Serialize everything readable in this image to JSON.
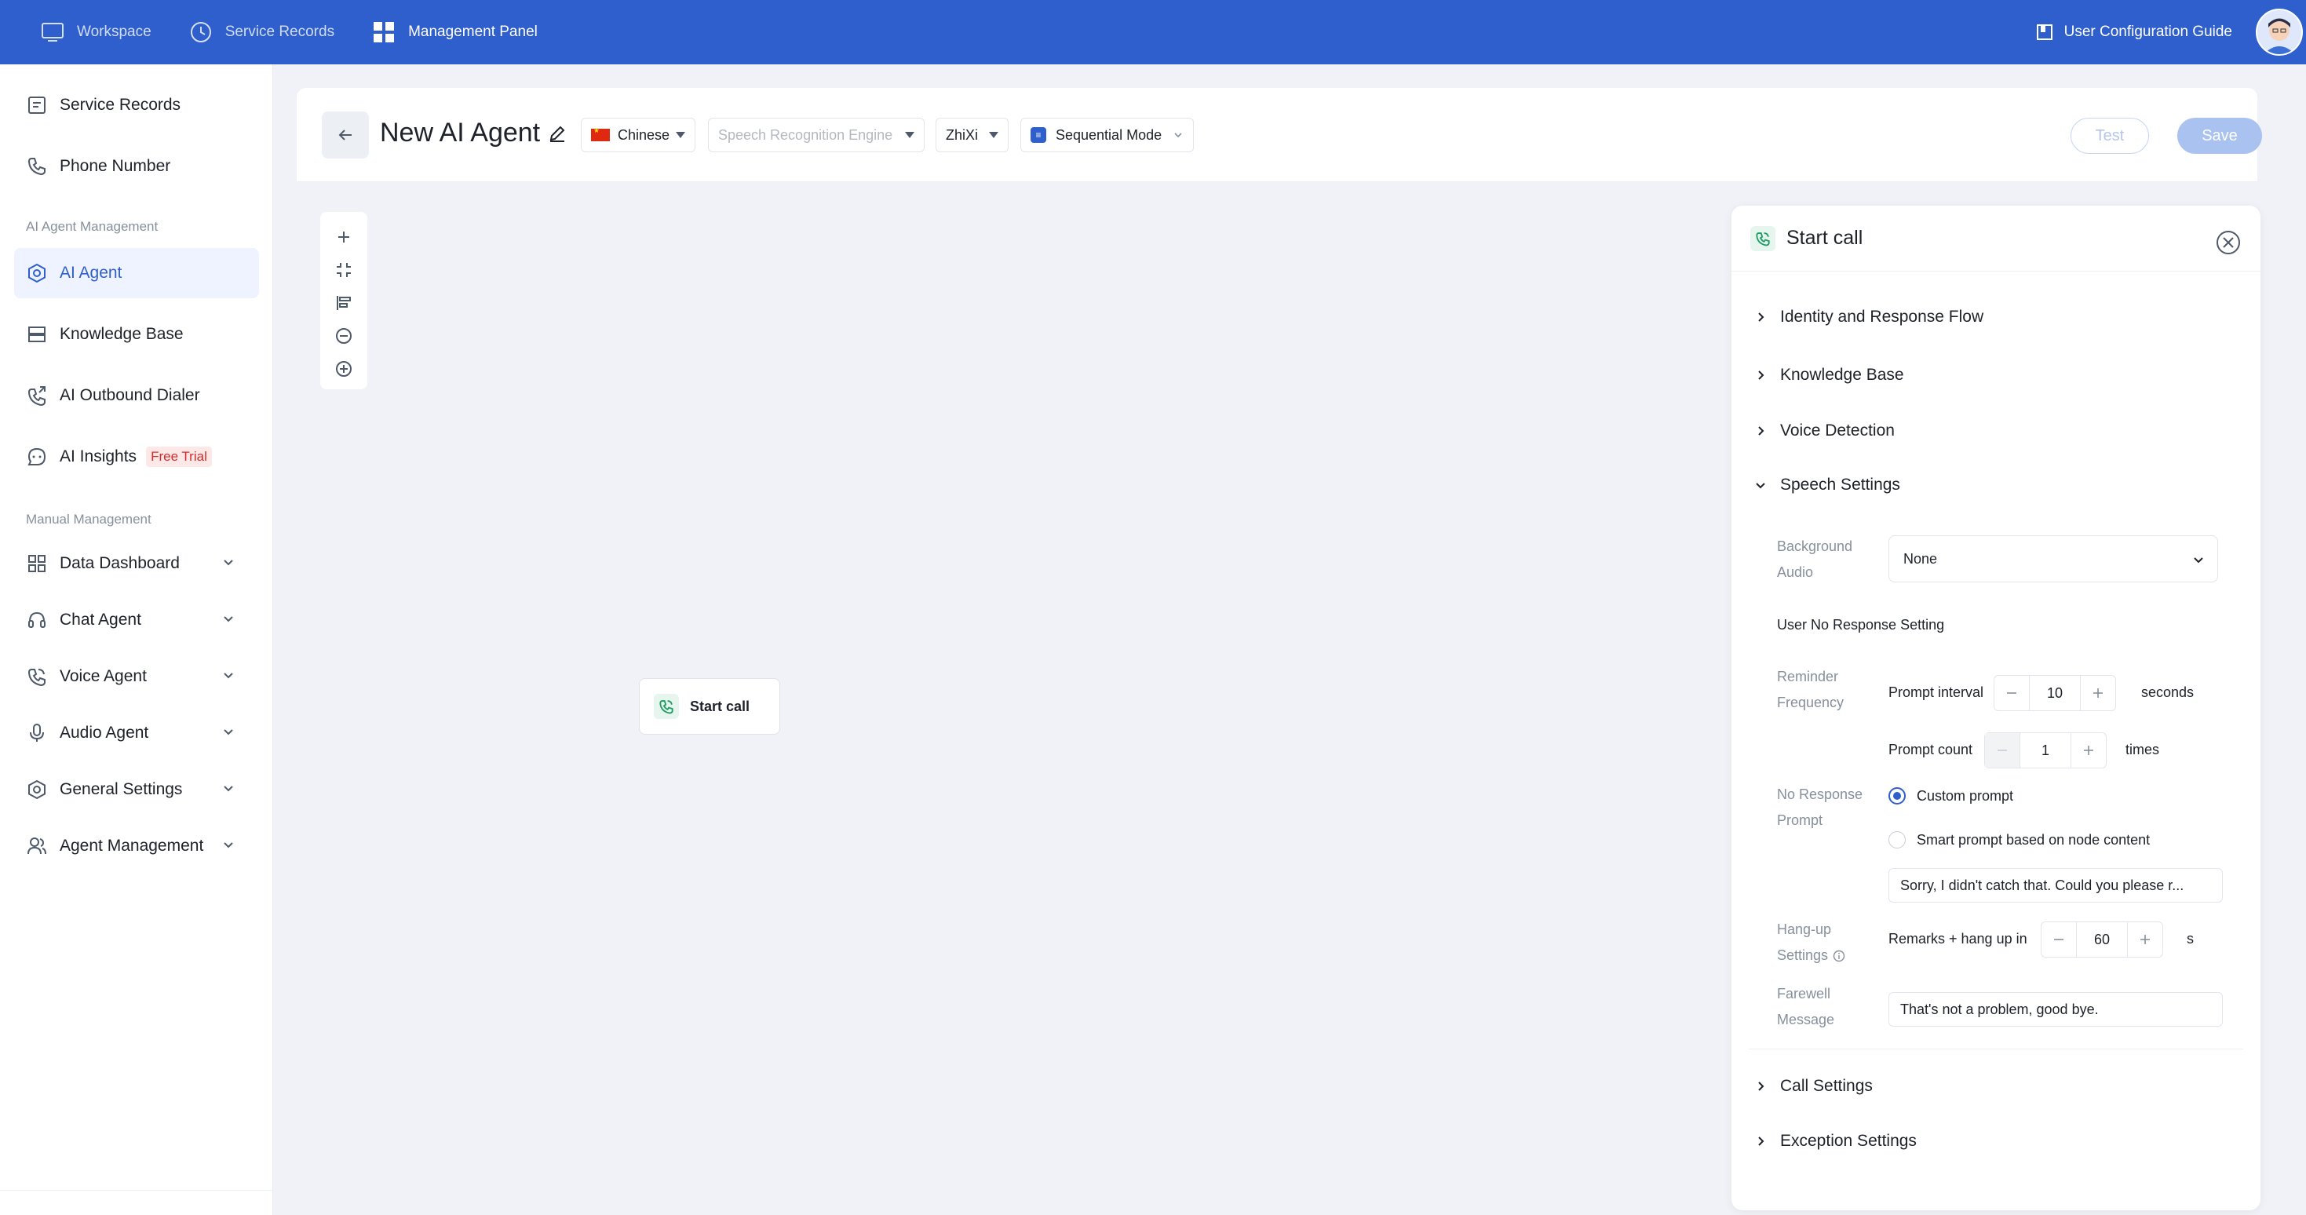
{
  "topbar": {
    "nav": [
      {
        "label": "Workspace",
        "icon": "monitor-icon"
      },
      {
        "label": "Service Records",
        "icon": "clock-icon"
      },
      {
        "label": "Management Panel",
        "icon": "grid-icon"
      }
    ],
    "guide_label": "User Configuration Guide",
    "accent_color": "#2e5fcc"
  },
  "sidebar": {
    "items": [
      {
        "label": "Service Records"
      },
      {
        "label": "Phone Number"
      }
    ],
    "group_ai": "AI Agent Management",
    "ai_items": [
      {
        "label": "AI Agent"
      },
      {
        "label": "Knowledge Base"
      },
      {
        "label": "AI Outbound Dialer"
      },
      {
        "label": "AI Insights",
        "badge": "Free Trial"
      }
    ],
    "group_manual": "Manual Management",
    "manual_items": [
      {
        "label": "Data Dashboard"
      },
      {
        "label": "Chat Agent"
      },
      {
        "label": "Voice Agent"
      },
      {
        "label": "Audio Agent"
      },
      {
        "label": "General Settings"
      },
      {
        "label": "Agent Management"
      }
    ]
  },
  "header": {
    "title": "New AI Agent",
    "language": "Chinese",
    "engine_placeholder": "Speech Recognition Engine",
    "voice": "ZhiXi",
    "mode": "Sequential Mode",
    "test_label": "Test",
    "save_label": "Save"
  },
  "canvas": {
    "node_label": "Start call"
  },
  "panel": {
    "title": "Start call",
    "sections": {
      "identity": "Identity and Response Flow",
      "knowledge": "Knowledge Base",
      "voice_detection": "Voice Detection",
      "speech": "Speech Settings",
      "call": "Call Settings",
      "exception": "Exception Settings"
    },
    "speech": {
      "bg_audio_label_1": "Background",
      "bg_audio_label_2": "Audio",
      "bg_audio_value": "None",
      "no_response_title": "User No Response Setting",
      "reminder_label_1": "Reminder",
      "reminder_label_2": "Frequency",
      "prompt_interval_label": "Prompt interval",
      "prompt_interval_value": "10",
      "prompt_interval_unit": "seconds",
      "prompt_count_label": "Prompt count",
      "prompt_count_value": "1",
      "prompt_count_unit": "times",
      "no_response_label_1": "No Response",
      "no_response_label_2": "Prompt",
      "radio_custom": "Custom prompt",
      "radio_smart": "Smart prompt based on node content",
      "custom_prompt_text": "Sorry, I didn't catch that. Could you please r...",
      "hangup_label_1": "Hang-up",
      "hangup_label_2": "Settings",
      "hangup_text": "Remarks + hang up in",
      "hangup_value": "60",
      "hangup_unit": "s",
      "farewell_label_1": "Farewell",
      "farewell_label_2": "Message",
      "farewell_text": "That's not a problem, good bye."
    }
  }
}
